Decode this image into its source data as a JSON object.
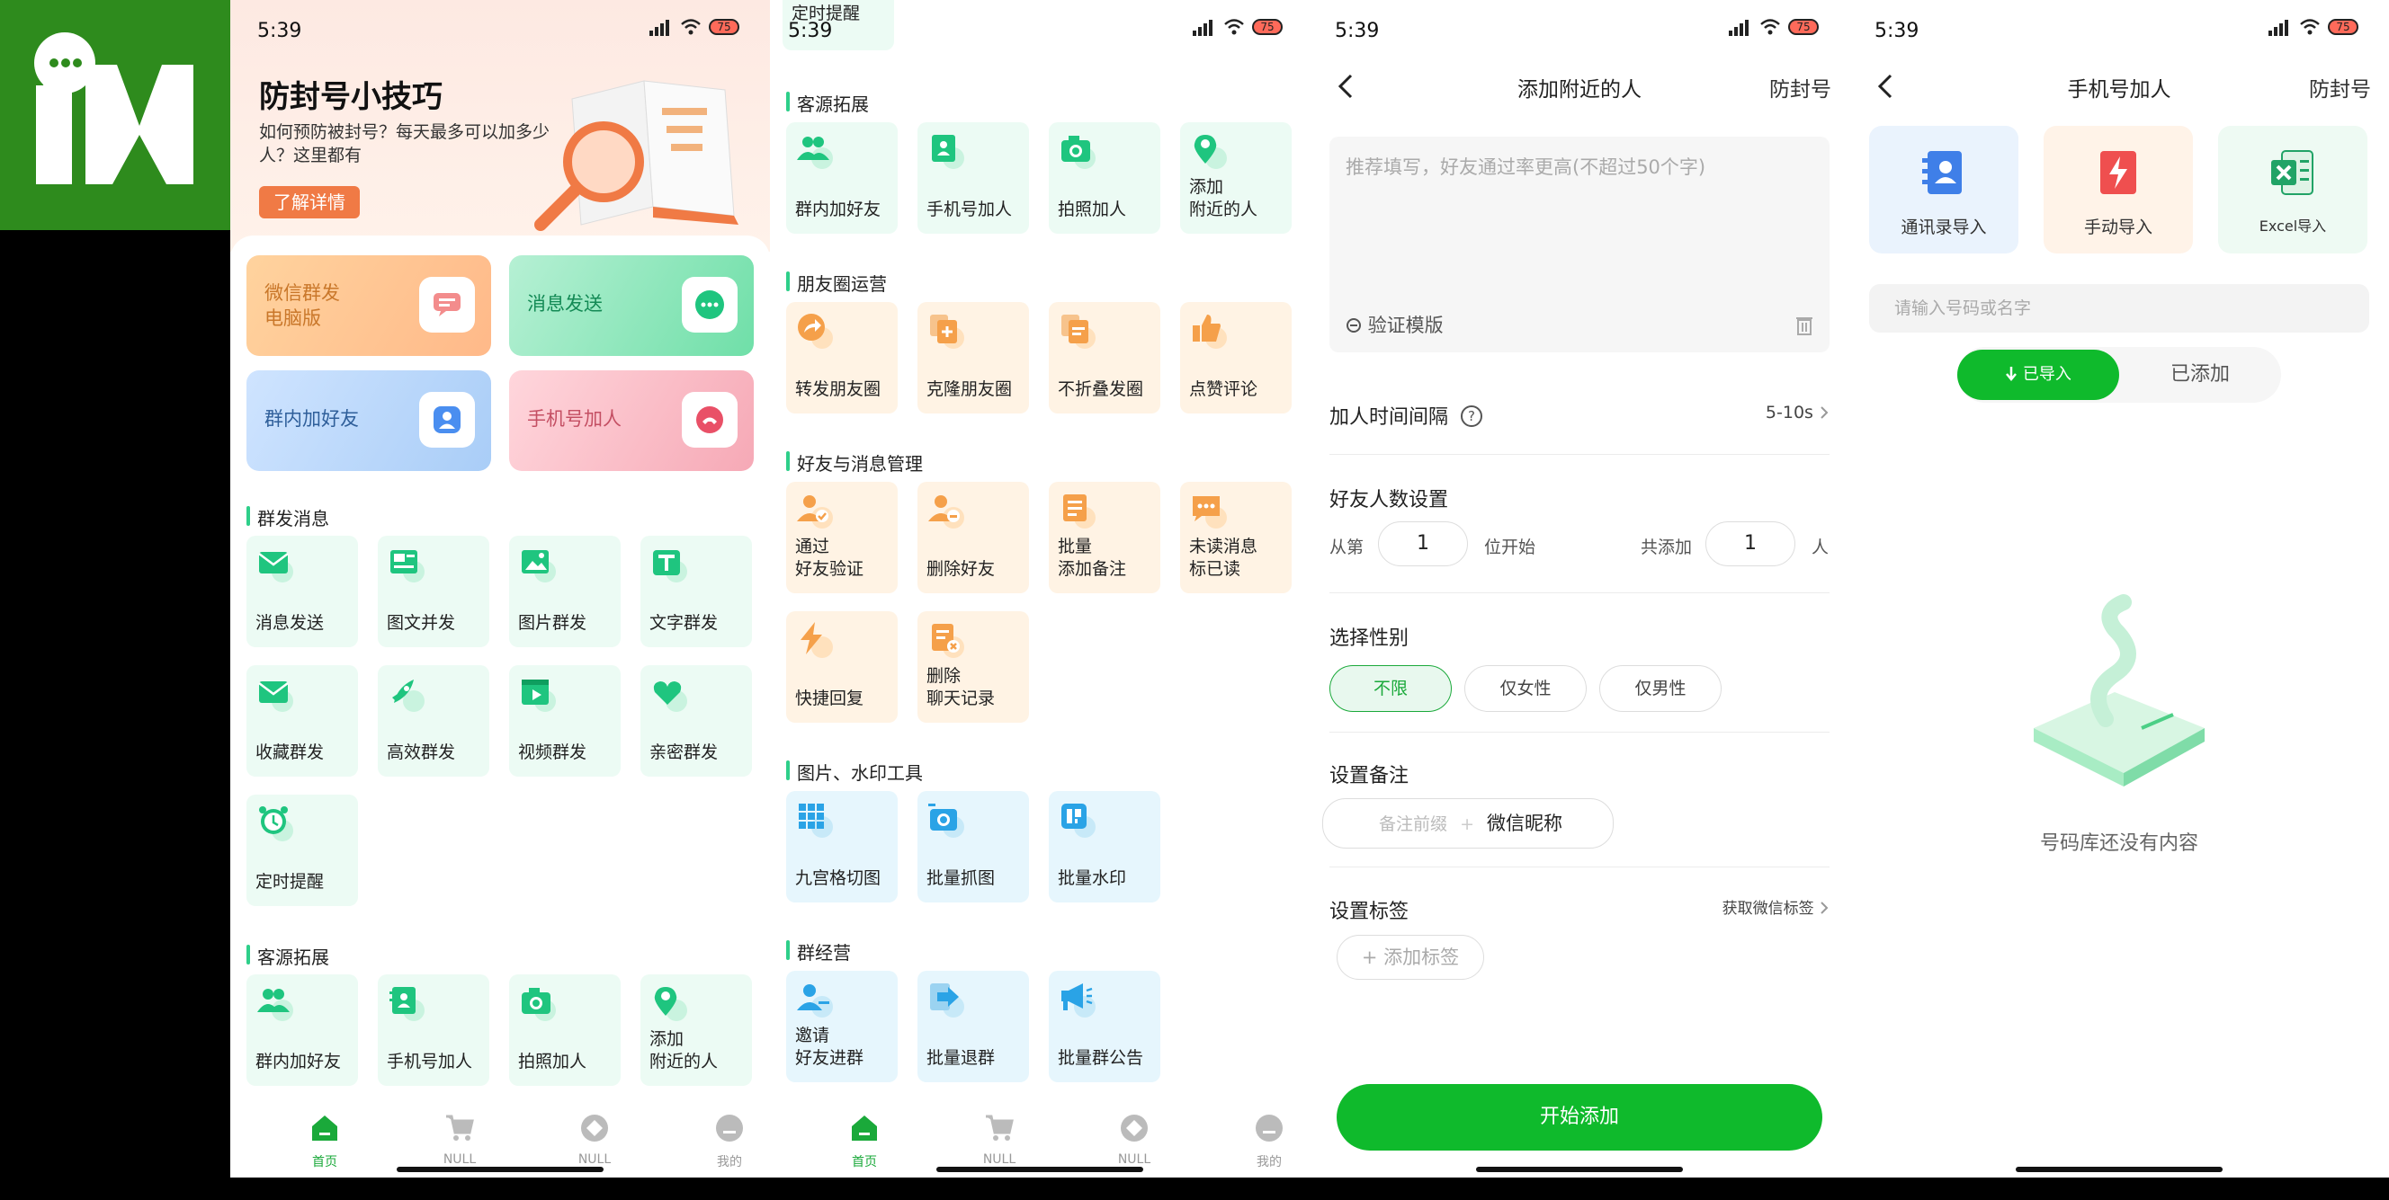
{
  "status": {
    "time": "5:39",
    "battery": "75"
  },
  "home": {
    "banner": {
      "title": "防封号小技巧",
      "subtitle": "如何预防被封号？每天最多可以加多少人？这里都有",
      "button": "了解详情"
    },
    "big_buttons": [
      {
        "label": "微信群发\n电脑版"
      },
      {
        "label": "消息发送"
      },
      {
        "label": "群内加好友"
      },
      {
        "label": "手机号加人"
      }
    ],
    "sections": [
      {
        "title": "群发消息",
        "items": [
          "消息发送",
          "图文并发",
          "图片群发",
          "文字群发",
          "收藏群发",
          "高效群发",
          "视频群发",
          "亲密群发",
          "定时提醒"
        ]
      },
      {
        "title": "客源拓展",
        "items": [
          "群内加好友",
          "手机号加人",
          "拍照加人",
          "添加\n附近的人"
        ]
      }
    ],
    "tabs": [
      "首页",
      "NULL",
      "NULL",
      "我的"
    ]
  },
  "screen2": {
    "top_cut": "定时提醒",
    "sections": [
      {
        "title": "客源拓展",
        "items": [
          "群内加好友",
          "手机号加人",
          "拍照加人",
          "添加\n附近的人"
        ]
      },
      {
        "title": "朋友圈运营",
        "items": [
          "转发朋友圈",
          "克隆朋友圈",
          "不折叠发圈",
          "点赞评论"
        ]
      },
      {
        "title": "好友与消息管理",
        "items": [
          "通过\n好友验证",
          "删除好友",
          "批量\n添加备注",
          "未读消息\n标已读",
          "快捷回复",
          "删除\n聊天记录"
        ]
      },
      {
        "title": "图片、水印工具",
        "items": [
          "九宫格切图",
          "批量抓图",
          "批量水印"
        ]
      },
      {
        "title": "群经营",
        "items": [
          "邀请\n好友进群",
          "批量退群",
          "批量群公告"
        ]
      }
    ],
    "tabs": [
      "首页",
      "NULL",
      "NULL",
      "我的"
    ]
  },
  "nearby": {
    "title": "添加附近的人",
    "right": "防封号",
    "textarea_placeholder": "推荐填写，好友通过率更高(不超过50个字)",
    "template_label": "验证模版",
    "interval_label": "加人时间间隔",
    "interval_value": "5-10s",
    "count_label": "好友人数设置",
    "from_label": "从第",
    "from_value": "1",
    "from_suffix": "位开始",
    "total_label": "共添加",
    "total_value": "1",
    "total_suffix": "人",
    "gender_label": "选择性别",
    "gender_options": [
      "不限",
      "仅女性",
      "仅男性"
    ],
    "remark_label": "设置备注",
    "remark_prefix": "备注前缀",
    "remark_plus": "+",
    "remark_nick": "微信昵称",
    "tag_label": "设置标签",
    "tag_fetch": "获取微信标签",
    "tag_add": "+ 添加标签",
    "start": "开始添加"
  },
  "phone_add": {
    "title": "手机号加人",
    "right": "防封号",
    "cards": [
      "通讯录导入",
      "手动导入",
      "Excel导入"
    ],
    "search_placeholder": "请输入号码或名字",
    "seg_on": "已导入",
    "seg_off": "已添加",
    "empty": "号码库还没有内容"
  },
  "colors": {
    "accent": "#0fba2c",
    "mint": "#2ecf8a",
    "orange": "#f5a04a",
    "blue": "#2aa3e6"
  }
}
